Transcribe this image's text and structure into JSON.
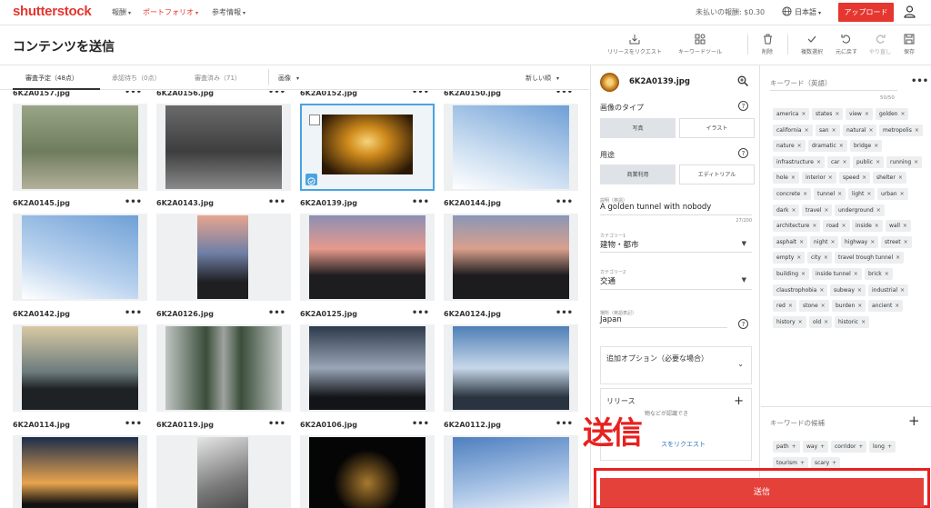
{
  "topbar": {
    "logo": "shutterstock",
    "nav": [
      {
        "label": "報酬",
        "active": false
      },
      {
        "label": "ポートフォリオ",
        "active": true
      },
      {
        "label": "参考情報",
        "active": false
      }
    ],
    "earnings": "未払いの報酬: $0.30",
    "language": "日本語",
    "upload_label": "アップロード"
  },
  "header": {
    "title": "コンテンツを送信",
    "tools": {
      "request_release": "リリースをリクエスト",
      "keyword_tool": "キーワードツール",
      "delete": "削除",
      "multi_select": "複数選択",
      "undo": "元に戻す",
      "redo": "やり直し",
      "save": "保存"
    }
  },
  "tabs": [
    {
      "label": "審査予定（48点）",
      "active": true
    },
    {
      "label": "承認待ち（0点）",
      "active": false
    },
    {
      "label": "審査済み（71）",
      "active": false
    }
  ],
  "filter": {
    "media": "画像",
    "sort": "新しい順"
  },
  "grid": [
    {
      "name": "6K2A0157.jpg",
      "thumb": {
        "kind": "land",
        "a": "#6f7c5e",
        "b": "#9aa587",
        "c": "#b4b09a"
      }
    },
    {
      "name": "6K2A0156.jpg",
      "thumb": {
        "kind": "land",
        "a": "#3e3e3e",
        "b": "#6a6a6a",
        "c": "#8a8a8a"
      }
    },
    {
      "name": "6K2A0152.jpg",
      "thumb": {
        "kind": "tunnel",
        "a": "#2a1806",
        "b": "#d08b1c",
        "c": "#f6d47a"
      },
      "selected": true
    },
    {
      "name": "6K2A0150.jpg",
      "thumb": {
        "kind": "sky",
        "a": "#6f9fd6",
        "b": "#c8dcf0",
        "c": "#ffffff"
      }
    },
    {
      "name": "6K2A0145.jpg",
      "thumb": {
        "kind": "sky",
        "a": "#6fa0d6",
        "b": "#b9d2ee",
        "c": "#ffffff"
      }
    },
    {
      "name": "6K2A0143.jpg",
      "thumb": {
        "kind": "portrait",
        "a": "#e7a58f",
        "b": "#6f7fa6",
        "c": "#1f1f22"
      }
    },
    {
      "name": "6K2A0139.jpg",
      "thumb": {
        "kind": "dusk",
        "a": "#e69a8c",
        "b": "#8c8fb4",
        "c": "#1d1d1f"
      }
    },
    {
      "name": "6K2A0144.jpg",
      "thumb": {
        "kind": "dusk",
        "a": "#d9a08c",
        "b": "#8a97b8",
        "c": "#1c1c1e"
      }
    },
    {
      "name": "6K2A0142.jpg",
      "thumb": {
        "kind": "mountain",
        "a": "#d9c9a3",
        "b": "#6c7b7e",
        "c": "#1e2225"
      }
    },
    {
      "name": "6K2A0126.jpg",
      "thumb": {
        "kind": "steps",
        "a": "#bfc5c2",
        "b": "#3b4d3a",
        "c": "#9ea39f"
      }
    },
    {
      "name": "6K2A0125.jpg",
      "thumb": {
        "kind": "cloudy",
        "a": "#2d3a4c",
        "b": "#9aa6b8",
        "c": "#121418"
      }
    },
    {
      "name": "6K2A0124.jpg",
      "thumb": {
        "kind": "cloudy",
        "a": "#4f7fb6",
        "b": "#c7d8ea",
        "c": "#2a3440"
      }
    },
    {
      "name": "6K2A0114.jpg",
      "thumb": {
        "kind": "sunset",
        "a": "#1b2d4c",
        "b": "#e8a44e",
        "c": "#121212"
      }
    },
    {
      "name": "6K2A0119.jpg",
      "thumb": {
        "kind": "bw",
        "a": "#e6e6e6",
        "b": "#7a7a7a",
        "c": "#3a3a3a"
      }
    },
    {
      "name": "6K2A0106.jpg",
      "thumb": {
        "kind": "night",
        "a": "#050505",
        "b": "#5a4018",
        "c": "#a77a30"
      }
    },
    {
      "name": "6K2A0112.jpg",
      "thumb": {
        "kind": "wisp",
        "a": "#4e7fc0",
        "b": "#a9c4e6",
        "c": "#ffffff"
      }
    }
  ],
  "detail": {
    "filename": "6K2A0139.jpg",
    "image_type_label": "画像のタイプ",
    "image_types": [
      {
        "label": "写真",
        "on": true
      },
      {
        "label": "イラスト",
        "on": false
      }
    ],
    "usage_label": "用途",
    "usages": [
      {
        "label": "商業利用",
        "on": true
      },
      {
        "label": "エディトリアル",
        "on": false
      }
    ],
    "description_label": "説明（英語）",
    "description": "A golden tunnel with nobody",
    "description_count": "27/200",
    "category1_label": "カテゴリー1",
    "category1": "建物・都市",
    "category2_label": "カテゴリー2",
    "category2": "交通",
    "location_label": "場所（英語表記）",
    "location": "Japan",
    "extra_options": "追加オプション（必要な場合）",
    "release_label": "リリース",
    "release_sub": "物などが認識でき",
    "release_link": "スをリクエスト"
  },
  "keywords": {
    "label": "キーワード（英語）",
    "count": "50/50",
    "tags": [
      "america",
      "states",
      "view",
      "golden",
      "california",
      "san",
      "natural",
      "metropolis",
      "nature",
      "dramatic",
      "bridge",
      "infrastructure",
      "car",
      "public",
      "running",
      "hole",
      "interior",
      "speed",
      "shelter",
      "concrete",
      "tunnel",
      "light",
      "urban",
      "dark",
      "travel",
      "underground",
      "architecture",
      "road",
      "inside",
      "wall",
      "asphalt",
      "night",
      "highway",
      "street",
      "empty",
      "city",
      "travel trough tunnel",
      "building",
      "inside tunnel",
      "brick",
      "claustrophobia",
      "subway",
      "industrial",
      "red",
      "stone",
      "burden",
      "ancient",
      "history",
      "old",
      "historic"
    ],
    "suggest_label": "キーワードの候補",
    "suggestions": [
      "path",
      "way",
      "corridor",
      "long",
      "tourism",
      "scary"
    ]
  },
  "submit_label": "送信",
  "overlay_text": "送信",
  "colors": {
    "brand": "#e5362f",
    "select": "#4aa3df",
    "highlight": "#e8211f"
  }
}
